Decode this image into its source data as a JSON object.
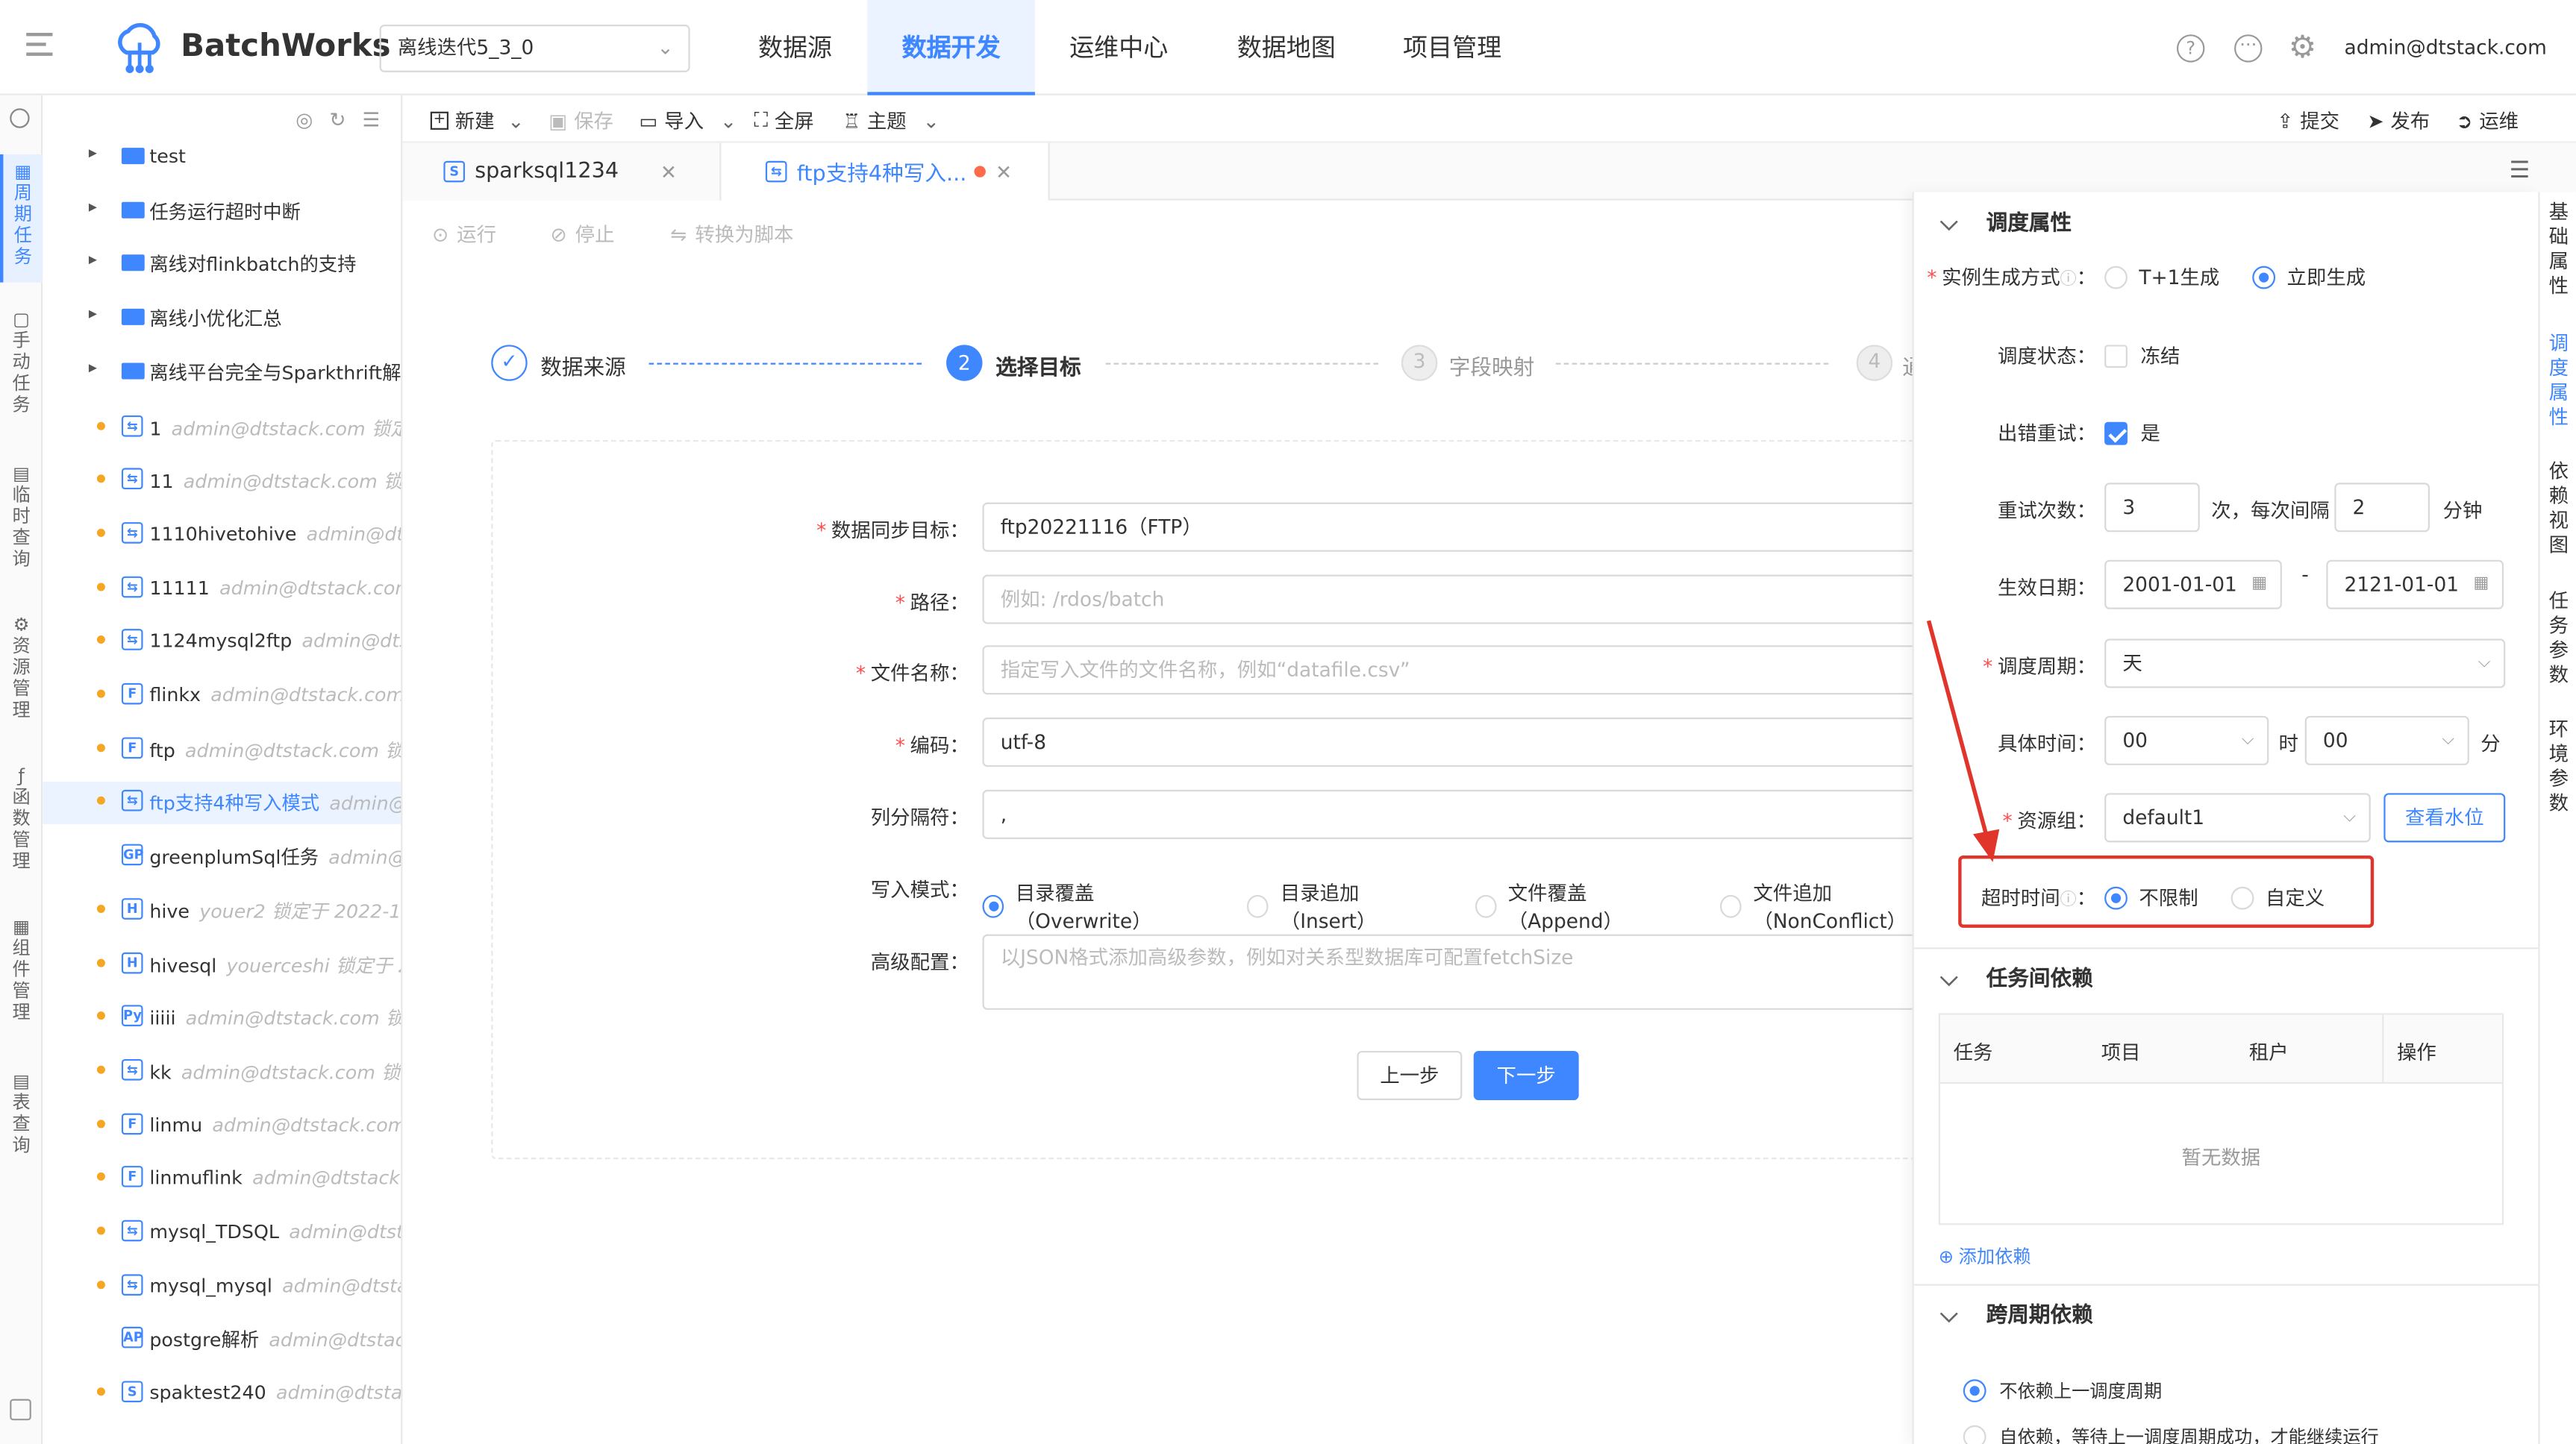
{
  "app": {
    "name": "BatchWorks",
    "project": "离线迭代5_3_0",
    "user": "admin@dtstack.com"
  },
  "nav": [
    "数据源",
    "数据开发",
    "运维中心",
    "数据地图",
    "项目管理"
  ],
  "rail": [
    "周期任务",
    "手动任务",
    "临时查询",
    "资源管理",
    "函数管理",
    "组件管理",
    "表查询"
  ],
  "toolbar": {
    "new": "新建",
    "save": "保存",
    "import": "导入",
    "fullscreen": "全屏",
    "theme": "主题",
    "submit": "提交",
    "publish": "发布",
    "ops": "运维"
  },
  "tabs": [
    {
      "label": "sparksql1234",
      "active": false
    },
    {
      "label": "ftp支持4种写入...",
      "active": true
    }
  ],
  "subbar": {
    "run": "运行",
    "stop": "停止",
    "convert": "转换为脚本"
  },
  "tree": [
    {
      "type": "folder",
      "name": "test"
    },
    {
      "type": "folder",
      "name": "任务运行超时中断"
    },
    {
      "type": "folder",
      "name": "离线对flinkbatch的支持"
    },
    {
      "type": "folder",
      "name": "离线小优化汇总"
    },
    {
      "type": "folder",
      "name": "离线平台完全与Sparkthrift解耦"
    },
    {
      "type": "file",
      "icon": "⇆",
      "name": "1",
      "meta": "admin@dtstack.com 锁定...",
      "dot": true
    },
    {
      "type": "file",
      "icon": "⇆",
      "name": "11",
      "meta": "admin@dtstack.com 锁...",
      "dot": true
    },
    {
      "type": "file",
      "icon": "⇆",
      "name": "1110hivetohive",
      "meta": "admin@dtst...",
      "dot": true
    },
    {
      "type": "file",
      "icon": "⇆",
      "name": "11111",
      "meta": "admin@dtstack.com...",
      "dot": true
    },
    {
      "type": "file",
      "icon": "⇆",
      "name": "1124mysql2ftp",
      "meta": "admin@dtst...",
      "dot": true
    },
    {
      "type": "file",
      "icon": "F",
      "name": "flinkx",
      "meta": "admin@dtstack.com ...",
      "dot": true
    },
    {
      "type": "file",
      "icon": "F",
      "name": "ftp",
      "meta": "admin@dtstack.com 锁...",
      "dot": true
    },
    {
      "type": "file",
      "icon": "⇆",
      "name": "ftp支持4种写入模式",
      "meta": "admin@...",
      "dot": true,
      "selected": true
    },
    {
      "type": "file",
      "icon": "GP",
      "name": "greenplumSql任务",
      "meta": "admin@d...",
      "dot": false
    },
    {
      "type": "file",
      "icon": "H",
      "name": "hive",
      "meta": "youer2 锁定于 2022-1...",
      "dot": true
    },
    {
      "type": "file",
      "icon": "H",
      "name": "hivesql",
      "meta": "youerceshi 锁定于 2...",
      "dot": true
    },
    {
      "type": "file",
      "icon": "Py",
      "name": "iiiii",
      "meta": "admin@dtstack.com 锁...",
      "dot": true
    },
    {
      "type": "file",
      "icon": "⇆",
      "name": "kk",
      "meta": "admin@dtstack.com 锁定...",
      "dot": true
    },
    {
      "type": "file",
      "icon": "F",
      "name": "linmu",
      "meta": "admin@dtstack.com ...",
      "dot": true
    },
    {
      "type": "file",
      "icon": "F",
      "name": "linmuflink",
      "meta": "admin@dtstack.c...",
      "dot": true
    },
    {
      "type": "file",
      "icon": "⇆",
      "name": "mysql_TDSQL",
      "meta": "admin@dtsta...",
      "dot": true
    },
    {
      "type": "file",
      "icon": "⇆",
      "name": "mysql_mysql",
      "meta": "admin@dtstac...",
      "dot": true
    },
    {
      "type": "file",
      "icon": "AP",
      "name": "postgre解析",
      "meta": "admin@dtstack...",
      "dot": false
    },
    {
      "type": "file",
      "icon": "S",
      "name": "spaktest240",
      "meta": "admin@dtstac...",
      "dot": true
    }
  ],
  "steps": [
    "数据来源",
    "选择目标",
    "字段映射",
    "通"
  ],
  "step_numbers": [
    "2",
    "3",
    "4"
  ],
  "form": {
    "target_label": "数据同步目标",
    "target_value": "ftp20221116（FTP）",
    "path_label": "路径",
    "path_placeholder": "例如: /rdos/batch",
    "filename_label": "文件名称",
    "filename_placeholder": "指定写入文件的文件名称，例如“datafile.csv”",
    "encoding_label": "编码",
    "encoding_value": "utf-8",
    "delimiter_label": "列分隔符",
    "delimiter_value": ",",
    "writemode_label": "写入模式",
    "writemodes": [
      "目录覆盖（Overwrite）",
      "目录追加（Insert）",
      "文件覆盖（Append）",
      "文件追加（NonConflict）"
    ],
    "advanced_label": "高级配置",
    "advanced_placeholder": "以JSON格式添加高级参数，例如对关系型数据库可配置fetchSize",
    "prev": "上一步",
    "next": "下一步"
  },
  "panel": {
    "schedule_title": "调度属性",
    "instance_label": "实例生成方式",
    "instance_opt1": "T+1生成",
    "instance_opt2": "立即生成",
    "status_label": "调度状态",
    "status_opt": "冻结",
    "retry_label": "出错重试",
    "retry_opt": "是",
    "retrycount_label": "重试次数",
    "retrycount": "3",
    "retry_unit1": "次，每次间隔",
    "retry_interval": "2",
    "retry_unit2": "分钟",
    "date_label": "生效日期",
    "date_start": "2001-01-01",
    "date_sep": "-",
    "date_end": "2121-01-01",
    "cycle_label": "调度周期",
    "cycle_value": "天",
    "time_label": "具体时间",
    "time_hour": "00",
    "time_h": "时",
    "time_min": "00",
    "time_m": "分",
    "resource_label": "资源组",
    "resource_value": "default1",
    "watermark_btn": "查看水位",
    "timeout_label": "超时时间",
    "timeout_opt1": "不限制",
    "timeout_opt2": "自定义",
    "dep_title": "任务间依赖",
    "dep_cols": [
      "任务",
      "项目",
      "租户",
      "操作"
    ],
    "dep_empty": "暂无数据",
    "dep_add": "添加依赖",
    "cross_title": "跨周期依赖",
    "cross_opt1": "不依赖上一调度周期",
    "cross_opt2": "自依赖，等待上一调度周期成功，才能继续运行"
  },
  "vtabs": [
    "基础属性",
    "调度属性",
    "依赖视图",
    "任务参数",
    "环境参数"
  ],
  "colors": {
    "accent": "#3f87ff",
    "annotation": "#e0352b",
    "lock_dot": "#f5a623"
  }
}
